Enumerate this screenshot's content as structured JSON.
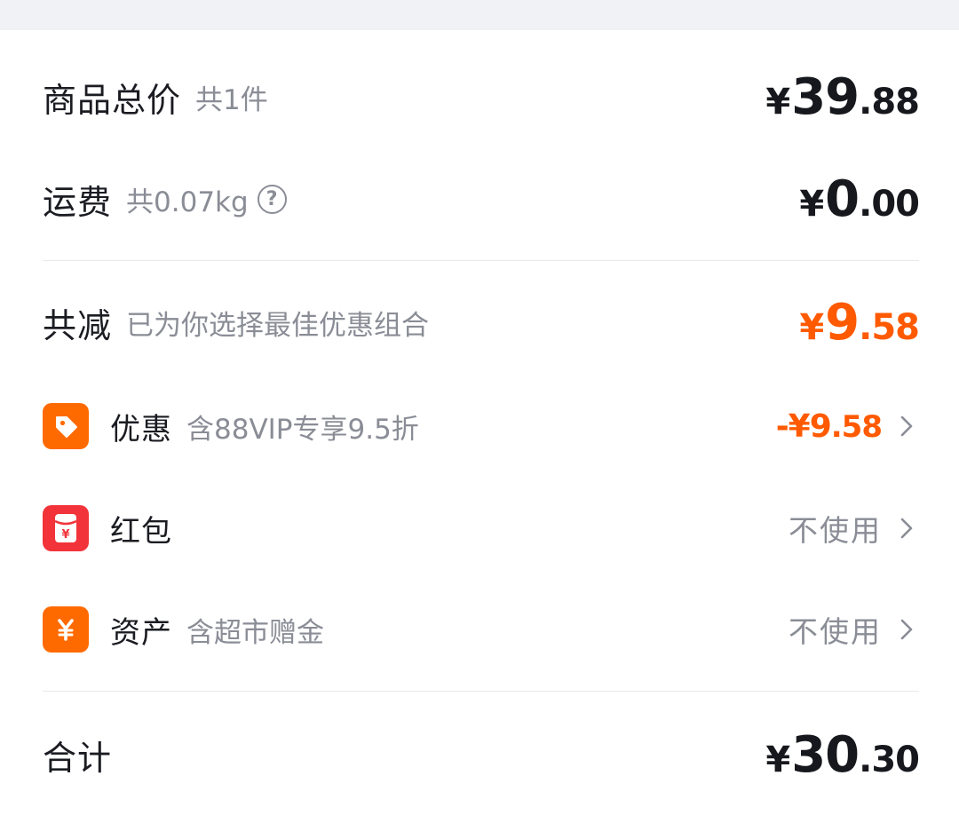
{
  "goods": {
    "label": "商品总价",
    "count_text": "共1件",
    "price": {
      "currency": "¥",
      "integer": "39",
      "decimal": ".88"
    }
  },
  "shipping": {
    "label": "运费",
    "weight_text": "共0.07kg",
    "help_glyph": "?",
    "price": {
      "currency": "¥",
      "integer": "0",
      "decimal": ".00"
    }
  },
  "discount_total": {
    "label": "共减",
    "note": "已为你选择最佳优惠组合",
    "price": {
      "currency": "¥",
      "integer": "9",
      "decimal": ".58"
    },
    "color": "#ff5a00"
  },
  "promo": {
    "icon": "tag-icon",
    "label": "优惠",
    "note": "含88VIP专享9.5折",
    "value_main": "-¥9",
    "value_decimal": ".58"
  },
  "red_packet": {
    "icon": "red-packet-icon",
    "label": "红包",
    "status": "不使用"
  },
  "assets": {
    "icon": "yuan-icon",
    "label": "资产",
    "note": "含超市赠金",
    "status": "不使用"
  },
  "total": {
    "label": "合计",
    "price": {
      "currency": "¥",
      "integer": "30",
      "decimal": ".30"
    }
  },
  "colors": {
    "accent_orange": "#ff5a00",
    "icon_orange": "#ff6a00",
    "icon_red": "#f2333a",
    "text_primary": "#1b1c22",
    "text_secondary": "#8a8d96"
  }
}
